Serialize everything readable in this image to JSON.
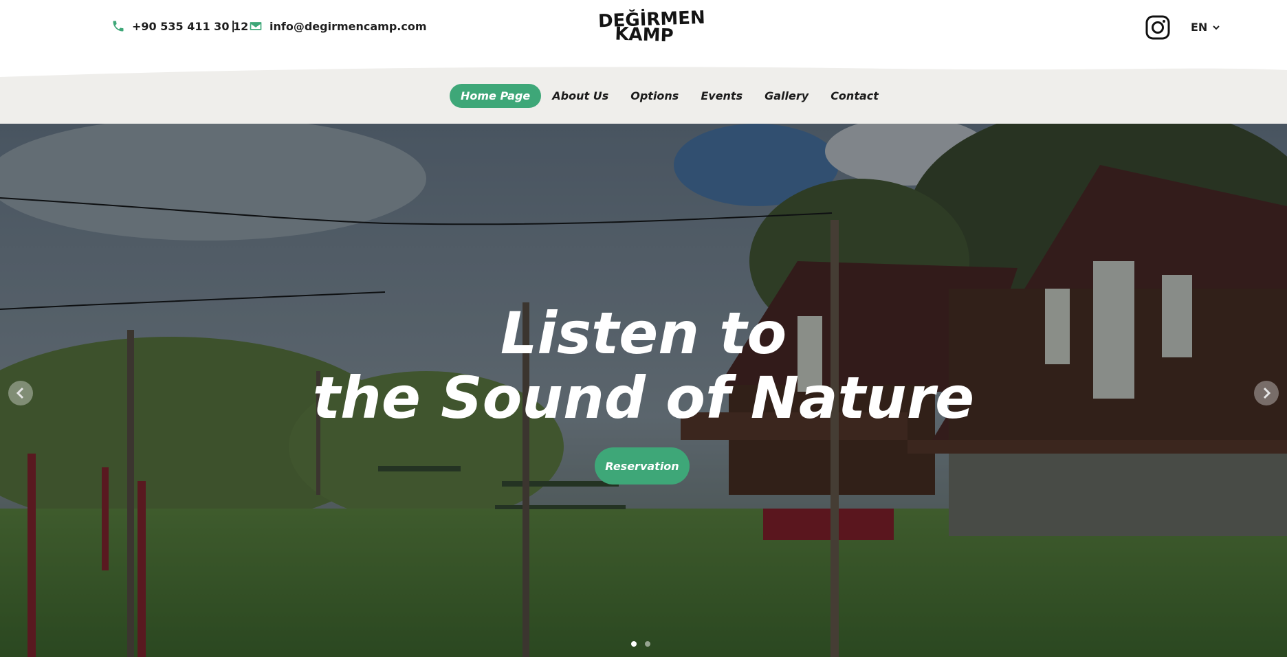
{
  "header": {
    "phone": "+90 535 411 30 12",
    "separator": "|",
    "email": "info@degirmencamp.com",
    "logo_line1": "DEĞİRMEN",
    "logo_line2": "KAMP",
    "language": "EN",
    "icons": [
      "phone-icon",
      "mail-icon",
      "instagram-icon",
      "chevron-down-icon"
    ]
  },
  "nav": {
    "items": [
      {
        "label": "Home Page",
        "active": true
      },
      {
        "label": "About Us"
      },
      {
        "label": "Options"
      },
      {
        "label": "Events"
      },
      {
        "label": "Gallery"
      },
      {
        "label": "Contact"
      }
    ]
  },
  "hero": {
    "headline_line1": "Listen to",
    "headline_line2": "the Sound of Nature",
    "cta_label": "Reservation",
    "slide_count": 2,
    "active_slide": 1
  },
  "colors": {
    "accent": "#3ea778",
    "nav_bg": "#efeeeb",
    "text": "#1e1e1e"
  }
}
